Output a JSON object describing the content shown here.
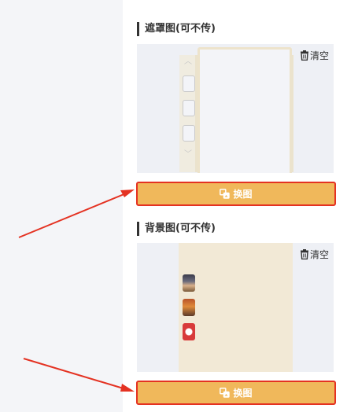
{
  "mask_section": {
    "title": "遮罩图(可不传)",
    "clear_label": "清空",
    "swap_label": "换图"
  },
  "background_section": {
    "title": "背景图(可不传)",
    "clear_label": "清空",
    "swap_label": "换图"
  },
  "icons": {
    "clear": "trash-icon",
    "swap": "swap-image-icon",
    "scroll_up": "chevron-up-icon",
    "scroll_down": "chevron-down-icon"
  },
  "colors": {
    "swap_button_bg": "#f0b85b",
    "swap_button_border": "#e43222",
    "arrow": "#e43222",
    "preview_bg": "#eef0f5",
    "paper": "#f2e9d6"
  }
}
